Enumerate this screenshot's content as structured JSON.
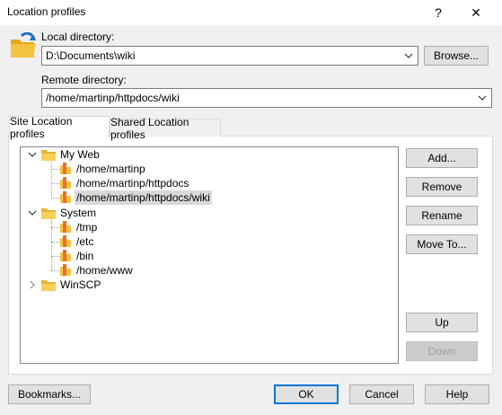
{
  "window": {
    "title": "Location profiles",
    "help_glyph": "?",
    "close_glyph": "✕"
  },
  "local": {
    "label": "Local directory:",
    "value": "D:\\Documents\\wiki",
    "browse_label": "Browse..."
  },
  "remote": {
    "label": "Remote directory:",
    "value": "/home/martinp/httpdocs/wiki"
  },
  "tabs": [
    {
      "label": "Site Location profiles",
      "active": true
    },
    {
      "label": "Shared Location profiles",
      "active": false
    }
  ],
  "tree": {
    "groups": [
      {
        "label": "My Web",
        "expanded": true,
        "items": [
          "/home/martinp",
          "/home/martinp/httpdocs",
          "/home/martinp/httpdocs/wiki"
        ],
        "selected_index": 2
      },
      {
        "label": "System",
        "expanded": true,
        "items": [
          "/tmp",
          "/etc",
          "/bin",
          "/home/www"
        ]
      },
      {
        "label": "WinSCP",
        "expanded": false,
        "items": []
      }
    ]
  },
  "side_buttons": {
    "add": "Add...",
    "remove": "Remove",
    "rename": "Rename",
    "move_to": "Move To...",
    "up": "Up",
    "down": "Down"
  },
  "bottom_buttons": {
    "bookmarks": "Bookmarks...",
    "ok": "OK",
    "cancel": "Cancel",
    "help": "Help"
  },
  "icons": {
    "app": "folder-sync-icon",
    "folder": "folder-icon",
    "location": "location-bookmark-icon"
  },
  "colors": {
    "folder": "#f5c342",
    "location_bar": "#e8702a",
    "accent": "#0078d7"
  }
}
